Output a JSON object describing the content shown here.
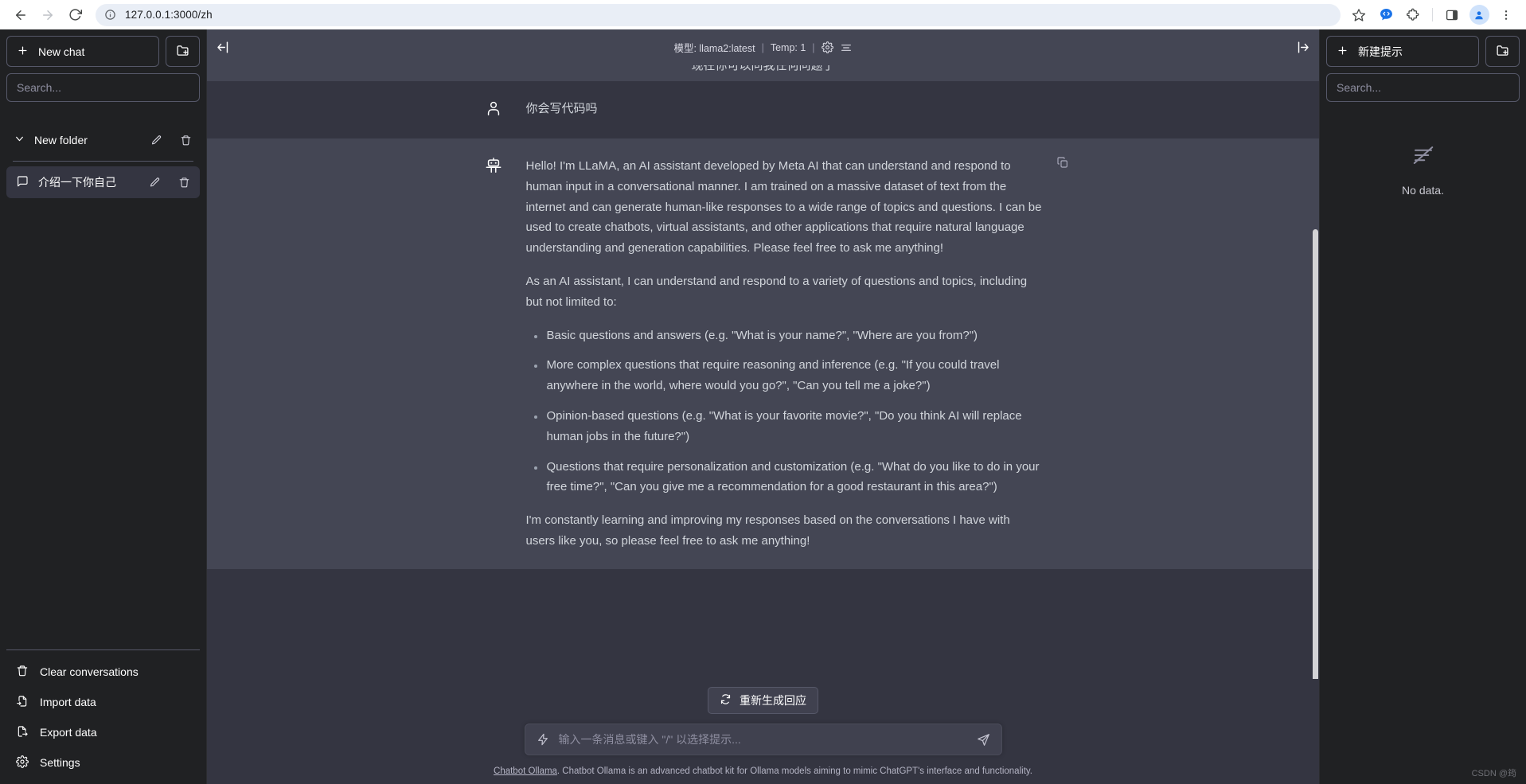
{
  "browser": {
    "url": "127.0.0.1:3000/zh",
    "back_label": "Back",
    "forward_label": "Forward",
    "reload_label": "Reload",
    "site_info_label": "View site information",
    "bookmark_label": "Bookmark this tab",
    "extensions_label": "Extensions",
    "side_panel_label": "Side panel",
    "profile_label": "Profile",
    "menu_label": "Customize and control Chrome"
  },
  "sidebar_left": {
    "new_chat_label": "New chat",
    "new_folder_label": "New folder button",
    "search_placeholder": "Search...",
    "folder": {
      "name": "New folder",
      "edit_label": "Rename folder",
      "delete_label": "Delete folder"
    },
    "conversations": [
      {
        "title": "介绍一下你自己",
        "edit_label": "Rename conversation",
        "delete_label": "Delete conversation"
      }
    ],
    "bottom_items": [
      {
        "label": "Clear conversations",
        "icon": "trash-icon"
      },
      {
        "label": "Import data",
        "icon": "import-icon"
      },
      {
        "label": "Export data",
        "icon": "export-icon"
      },
      {
        "label": "Settings",
        "icon": "gear-icon"
      }
    ]
  },
  "header": {
    "collapse_left_label": "Collapse left sidebar",
    "collapse_right_label": "Collapse right sidebar",
    "model_text": "模型: llama2:latest",
    "separator": "|",
    "temp_text": "Temp: 1",
    "settings_label": "Conversation settings",
    "list_label": "System prompt"
  },
  "chat": {
    "cut_off_line": "现在你可以问我任何问题了",
    "messages": [
      {
        "role": "user",
        "avatar_icon": "user-icon",
        "text": "你会写代码吗"
      },
      {
        "role": "assistant",
        "avatar_icon": "robot-icon",
        "copy_label": "Copy response",
        "paragraph_1": "Hello! I'm LLaMA, an AI assistant developed by Meta AI that can understand and respond to human input in a conversational manner. I am trained on a massive dataset of text from the internet and can generate human-like responses to a wide range of topics and questions. I can be used to create chatbots, virtual assistants, and other applications that require natural language understanding and generation capabilities. Please feel free to ask me anything!",
        "paragraph_2": "As an AI assistant, I can understand and respond to a variety of questions and topics, including but not limited to:",
        "bullets": [
          "Basic questions and answers (e.g. \"What is your name?\", \"Where are you from?\")",
          "More complex questions that require reasoning and inference (e.g. \"If you could travel anywhere in the world, where would you go?\", \"Can you tell me a joke?\")",
          "Opinion-based questions (e.g. \"What is your favorite movie?\", \"Do you think AI will replace human jobs in the future?\")",
          "Questions that require personalization and customization (e.g. \"What do you like to do in your free time?\", \"Can you give me a recommendation for a good restaurant in this area?\")"
        ],
        "paragraph_3": "I'm constantly learning and improving my responses based on the conversations I have with users like you, so please feel free to ask me anything!"
      }
    ]
  },
  "composer": {
    "regenerate_label": "重新生成回应",
    "placeholder": "输入一条消息或键入 \"/\" 以选择提示...",
    "send_label": "Send message",
    "prompt_shortcut_label": "Prompt shortcut"
  },
  "footer": {
    "link_text": "Chatbot Ollama",
    "description": ". Chatbot Ollama is an advanced chatbot kit for Ollama models aiming to mimic ChatGPT's interface and functionality."
  },
  "sidebar_right": {
    "new_prompt_label": "新建提示",
    "new_folder_label": "New prompt folder",
    "search_placeholder": "Search...",
    "empty_state": "No data."
  },
  "watermark": "CSDN @筠",
  "colors": {
    "sidebar_bg": "#202123",
    "chat_bg": "#343541",
    "assistant_bg": "#444654",
    "border": "#565869",
    "text_primary": "#d1d5db",
    "text_muted": "#8e8ea0",
    "accent_blue": "#1a73e8"
  }
}
